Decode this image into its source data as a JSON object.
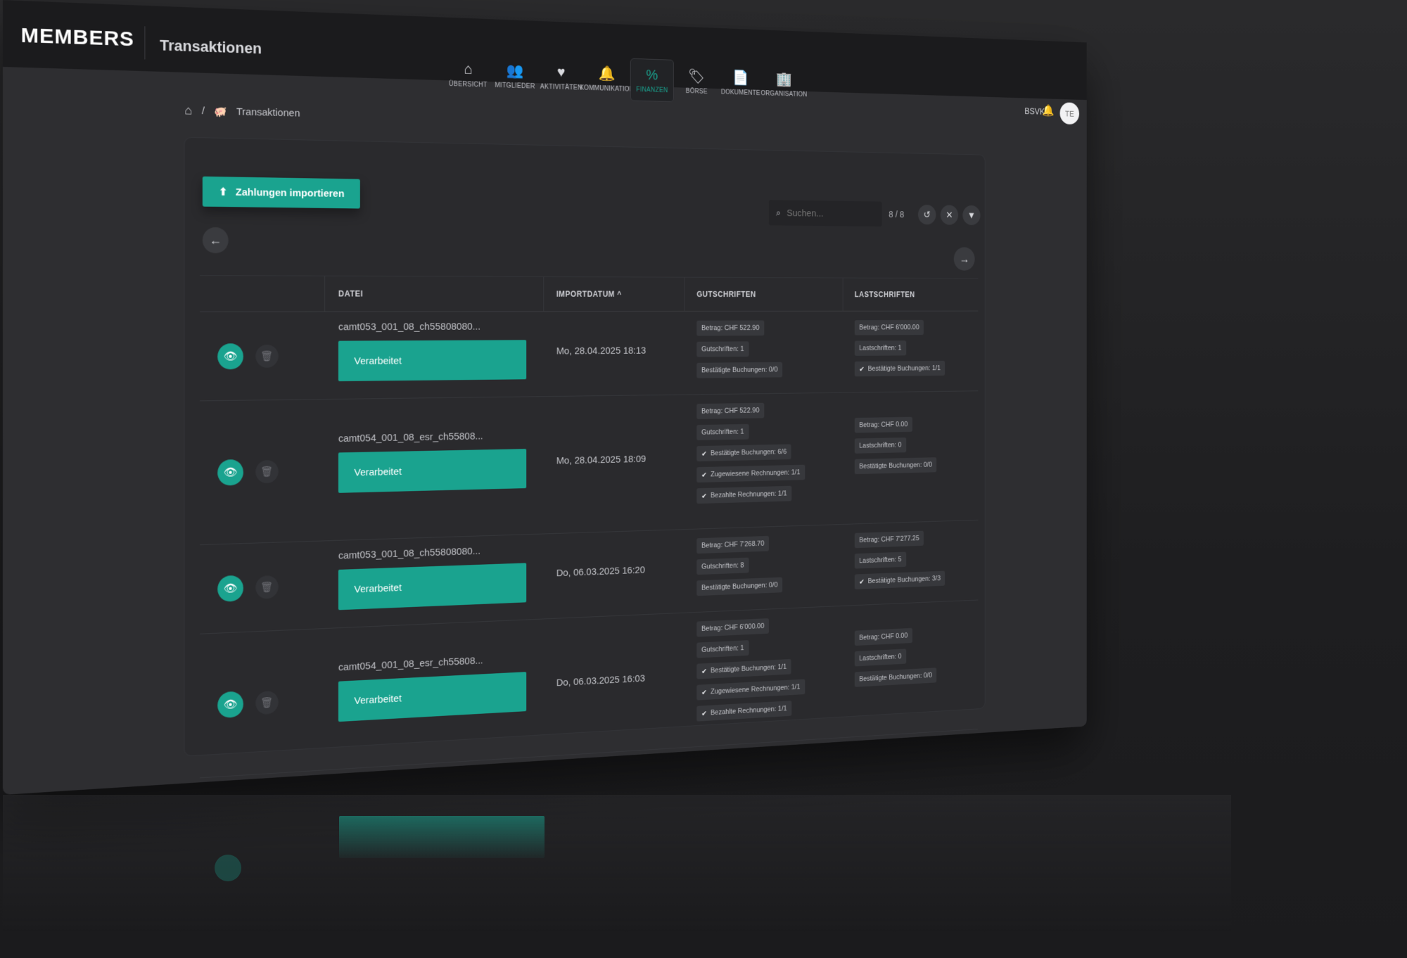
{
  "header": {
    "logo": "MEMBERS",
    "title": "Transaktionen",
    "org": "BSVK",
    "avatar": "TE"
  },
  "nav": [
    {
      "label": "ÜBERSICHT",
      "icon": "home-icon",
      "glyph": "⌂",
      "active": false
    },
    {
      "label": "MITGLIEDER",
      "icon": "users-icon",
      "glyph": "👥",
      "active": false
    },
    {
      "label": "AKTIVITÄTEN",
      "icon": "heart-pulse-icon",
      "glyph": "♥",
      "active": false
    },
    {
      "label": "KOMMUNIKATION",
      "icon": "bell-icon",
      "glyph": "🔔",
      "active": false
    },
    {
      "label": "FINANZEN",
      "icon": "percent-icon",
      "glyph": "%",
      "active": true
    },
    {
      "label": "BÖRSE",
      "icon": "tag-icon",
      "glyph": "🏷",
      "active": false
    },
    {
      "label": "DOKUMENTE",
      "icon": "document-icon",
      "glyph": "📄",
      "active": false
    },
    {
      "label": "ORGANISATION",
      "icon": "building-icon",
      "glyph": "🏢",
      "active": false
    }
  ],
  "breadcrumb": {
    "separator": "/",
    "current": "Transaktionen"
  },
  "toolbar": {
    "import_label": "Zahlungen importieren",
    "search_placeholder": "Suchen...",
    "count": "8 / 8"
  },
  "table": {
    "columns": [
      "DATEI",
      "IMPORTDATUM ^",
      "GUTSCHRIFTEN",
      "LASTSCHRIFTEN"
    ],
    "rows": [
      {
        "file": "camt053_001_08_ch55808080...",
        "status": "Verarbeitet",
        "date": "Mo, 28.04.2025 18:13",
        "gutschriften": [
          {
            "text": "Betrag: CHF 522.90",
            "check": false
          },
          {
            "text": "Gutschriften: 1",
            "check": false
          },
          {
            "text": "Bestätigte Buchungen: 0/0",
            "check": false
          }
        ],
        "lastschriften": [
          {
            "text": "Betrag: CHF 6'000.00",
            "check": false
          },
          {
            "text": "Lastschriften: 1",
            "check": false
          },
          {
            "text": "Bestätigte Buchungen: 1/1",
            "check": true
          }
        ]
      },
      {
        "file": "camt054_001_08_esr_ch55808...",
        "status": "Verarbeitet",
        "date": "Mo, 28.04.2025 18:09",
        "gutschriften": [
          {
            "text": "Betrag: CHF 522.90",
            "check": false
          },
          {
            "text": "Gutschriften: 1",
            "check": false
          },
          {
            "text": "Bestätigte Buchungen: 6/6",
            "check": true
          },
          {
            "text": "Zugewiesene Rechnungen: 1/1",
            "check": true
          },
          {
            "text": "Bezahlte Rechnungen: 1/1",
            "check": true
          }
        ],
        "lastschriften": [
          {
            "text": "Betrag: CHF 0.00",
            "check": false
          },
          {
            "text": "Lastschriften: 0",
            "check": false
          },
          {
            "text": "Bestätigte Buchungen: 0/0",
            "check": false
          }
        ]
      },
      {
        "file": "camt053_001_08_ch55808080...",
        "status": "Verarbeitet",
        "date": "Do, 06.03.2025 16:20",
        "gutschriften": [
          {
            "text": "Betrag: CHF 7'268.70",
            "check": false
          },
          {
            "text": "Gutschriften: 8",
            "check": false
          },
          {
            "text": "Bestätigte Buchungen: 0/0",
            "check": false
          }
        ],
        "lastschriften": [
          {
            "text": "Betrag: CHF 7'277.25",
            "check": false
          },
          {
            "text": "Lastschriften: 5",
            "check": false
          },
          {
            "text": "Bestätigte Buchungen: 3/3",
            "check": true
          }
        ]
      },
      {
        "file": "camt054_001_08_esr_ch55808...",
        "status": "Verarbeitet",
        "date": "Do, 06.03.2025 16:03",
        "gutschriften": [
          {
            "text": "Betrag: CHF 6'000.00",
            "check": false
          },
          {
            "text": "Gutschriften: 1",
            "check": false
          },
          {
            "text": "Bestätigte Buchungen: 1/1",
            "check": true
          },
          {
            "text": "Zugewiesene Rechnungen: 1/1",
            "check": true
          },
          {
            "text": "Bezahlte Rechnungen: 1/1",
            "check": true
          }
        ],
        "lastschriften": [
          {
            "text": "Betrag: CHF 0.00",
            "check": false
          },
          {
            "text": "Lastschriften: 0",
            "check": false
          },
          {
            "text": "Bestätigte Buchungen: 0/0",
            "check": false
          }
        ]
      }
    ]
  },
  "colors": {
    "accent": "#1aa38f",
    "background": "#2e2e31",
    "topbar": "#1b1b1d"
  }
}
